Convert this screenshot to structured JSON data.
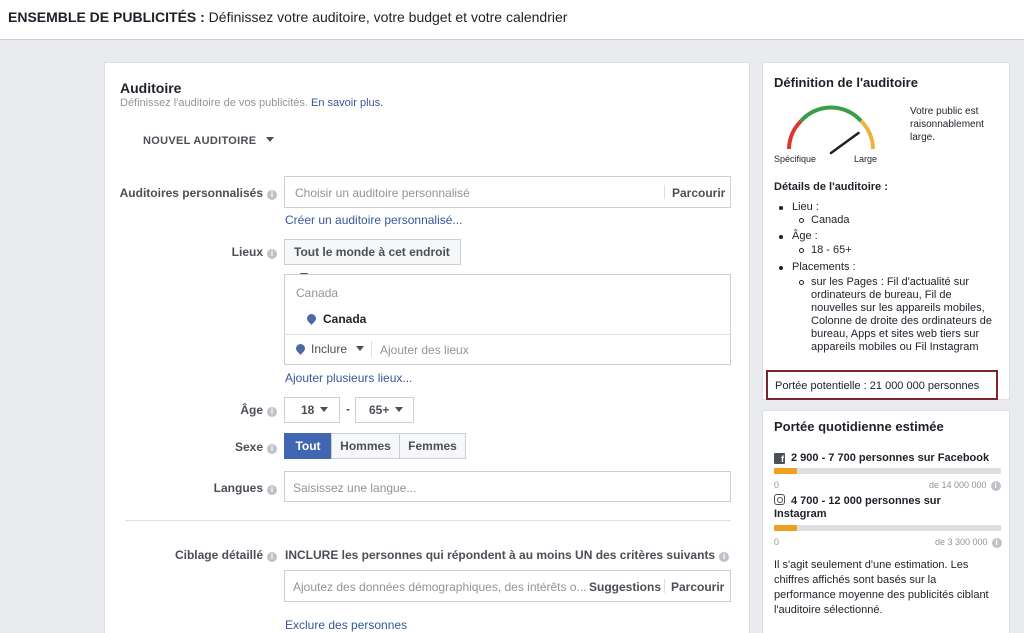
{
  "header": {
    "title_bold": "ENSEMBLE DE PUBLICITÉS :",
    "title_rest": " Définissez votre auditoire, votre budget et votre calendrier"
  },
  "audience": {
    "title": "Auditoire",
    "subtitle": "Définissez l'auditoire de vos publicités.",
    "learn_more": "En savoir plus.",
    "new_audience": "NOUVEL AUDITOIRE",
    "custom": {
      "label": "Auditoires personnalisés",
      "placeholder": "Choisir un auditoire personnalisé",
      "browse": "Parcourir",
      "create_link": "Créer un auditoire personnalisé..."
    },
    "locations": {
      "label": "Lieux",
      "scope": "Tout le monde à cet endroit",
      "country_header": "Canada",
      "selected": "Canada",
      "include": "Inclure",
      "add_placeholder": "Ajouter des lieux",
      "add_multiple": "Ajouter plusieurs lieux..."
    },
    "age": {
      "label": "Âge",
      "min": "18",
      "dash": "-",
      "max": "65+"
    },
    "gender": {
      "label": "Sexe",
      "options": [
        "Tout",
        "Hommes",
        "Femmes"
      ],
      "selected": "Tout"
    },
    "languages": {
      "label": "Langues",
      "placeholder": "Saisissez une langue..."
    },
    "detailed": {
      "label": "Ciblage détaillé",
      "include_text": "INCLURE les personnes qui répondent à au moins UN des critères suivants",
      "placeholder": "Ajoutez des données démographiques, des intérêts o...",
      "suggestions": "Suggestions",
      "browse": "Parcourir",
      "exclude_link": "Exclure des personnes"
    }
  },
  "definition": {
    "title": "Définition de l'auditoire",
    "gauge_left": "Spécifique",
    "gauge_right": "Large",
    "gauge_level": 0.8,
    "gauge_text": [
      "Votre public est",
      "raisonnablement",
      "large."
    ],
    "details_title": "Détails de l'auditoire :",
    "location_label": "Lieu :",
    "location_value": "Canada",
    "age_label": "Âge :",
    "age_value": "18 - 65+",
    "placements_label": "Placements :",
    "placements_lines": [
      "sur les Pages : Fil d'actualité sur",
      "ordinateurs de bureau, Fil de",
      "nouvelles sur les appareils mobiles,",
      "Colonne de droite des ordinateurs de",
      "bureau, Apps et sites web tiers sur",
      "appareils mobiles ou Fil Instagram"
    ],
    "potential_reach": "Portée potentielle : 21 000 000 personnes"
  },
  "daily": {
    "title": "Portée quotidienne estimée",
    "facebook": {
      "text": "2 900 - 7 700 personnes sur Facebook",
      "min": "0",
      "max": "de 14 000 000",
      "fill": 0.1
    },
    "instagram": {
      "text_line1": "4 700 - 12 000 personnes sur",
      "text_line2": "Instagram",
      "min": "0",
      "max": "de 3 300 000",
      "fill": 0.1
    },
    "note_lines": [
      "Il s'agit seulement d'une estimation. Les",
      "chiffres affichés sont basés sur la",
      "performance moyenne des publicités ciblant",
      "l'auditoire sélectionné."
    ]
  },
  "colors": {
    "accent": "#4267b2",
    "link": "#365899",
    "bar": "#f0a01e",
    "highlight": "#7a2430"
  }
}
